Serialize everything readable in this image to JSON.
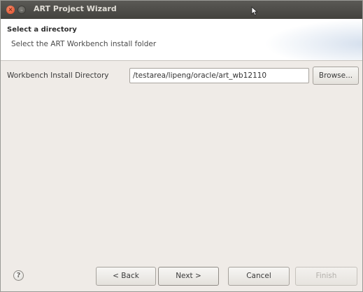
{
  "window": {
    "title": "ART Project Wizard",
    "controls": {
      "close": "×",
      "minimize": "–"
    }
  },
  "header": {
    "title": "Select a directory",
    "description": "Select the ART Workbench install folder"
  },
  "form": {
    "directory_label": "Workbench Install Directory",
    "directory_value": "/testarea/lipeng/oracle/art_wb12110",
    "browse_label": "Browse..."
  },
  "footer": {
    "help_icon": "help-icon",
    "help_glyph": "?",
    "back_label": "< Back",
    "next_label": "Next >",
    "cancel_label": "Cancel",
    "finish_label": "Finish",
    "finish_enabled": false
  },
  "colors": {
    "titlebar": "#4c4b47",
    "window_bg": "#efebe7",
    "header_bg": "#ffffff",
    "close_button": "#e5532d"
  }
}
